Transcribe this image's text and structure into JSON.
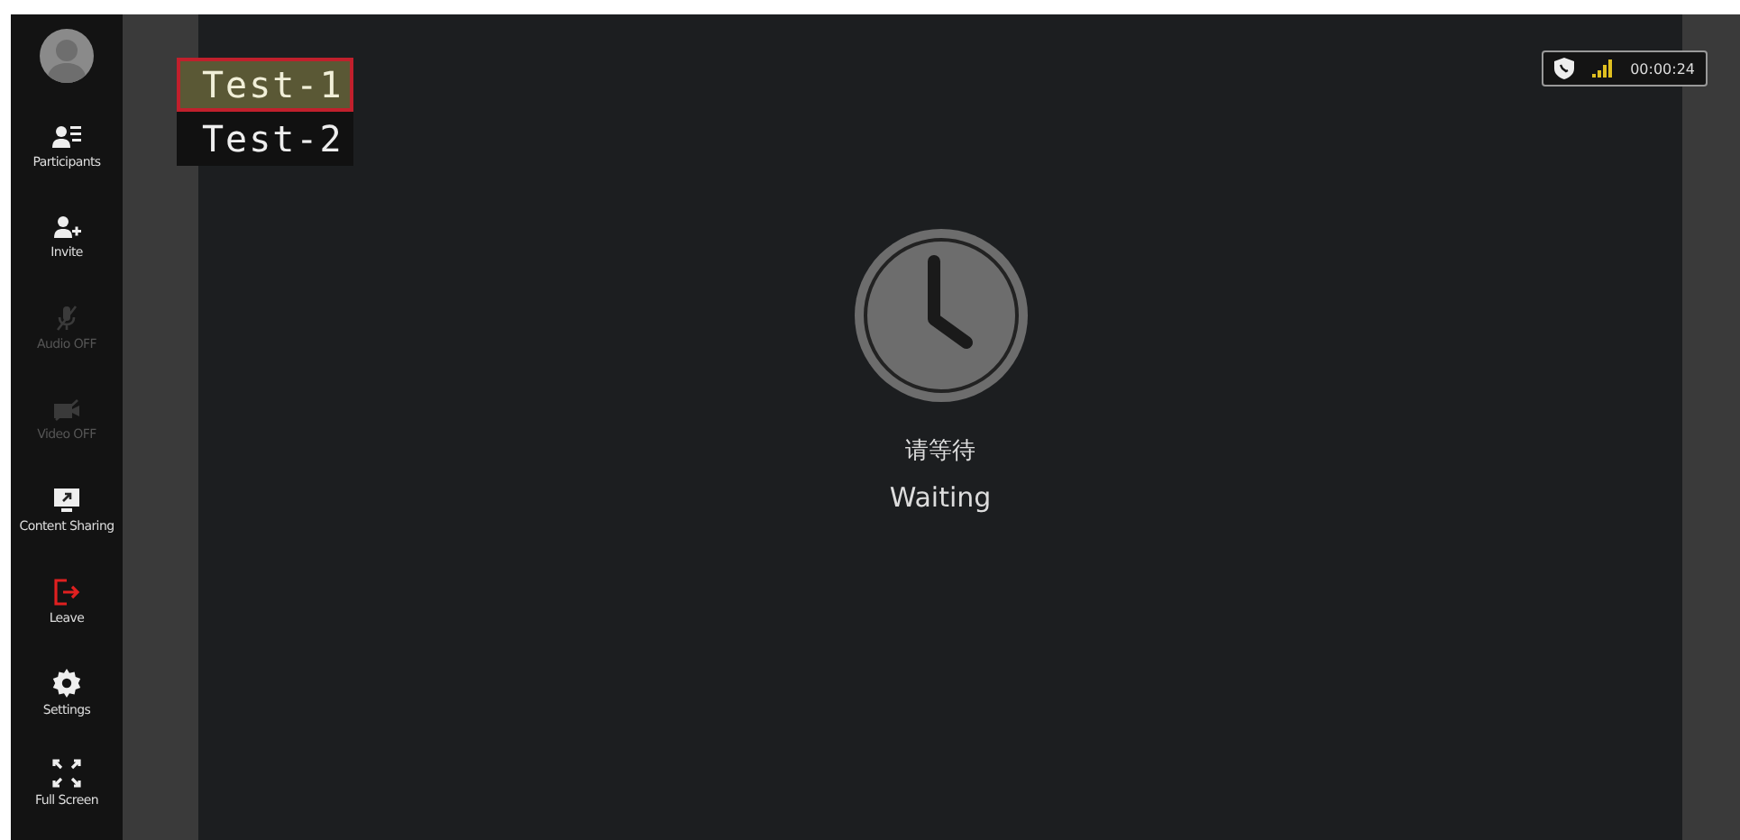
{
  "sidebar": {
    "items": [
      {
        "label": "Participants",
        "kind": "participants",
        "disabled": false
      },
      {
        "label": "Invite",
        "kind": "invite",
        "disabled": false
      },
      {
        "label": "Audio OFF",
        "kind": "audio",
        "disabled": true
      },
      {
        "label": "Video OFF",
        "kind": "video",
        "disabled": true
      },
      {
        "label": "Content Sharing",
        "kind": "share",
        "disabled": false
      },
      {
        "label": "Leave",
        "kind": "leave",
        "disabled": false
      },
      {
        "label": "Settings",
        "kind": "settings",
        "disabled": false
      },
      {
        "label": "Full Screen",
        "kind": "fullscreen",
        "disabled": false
      }
    ]
  },
  "participants": [
    {
      "name": "Test-1",
      "selected": true
    },
    {
      "name": "Test-2",
      "selected": false
    }
  ],
  "status": {
    "duration": "00:00:24"
  },
  "waiting": {
    "title_zh": "请等待",
    "title_en": "Waiting"
  }
}
